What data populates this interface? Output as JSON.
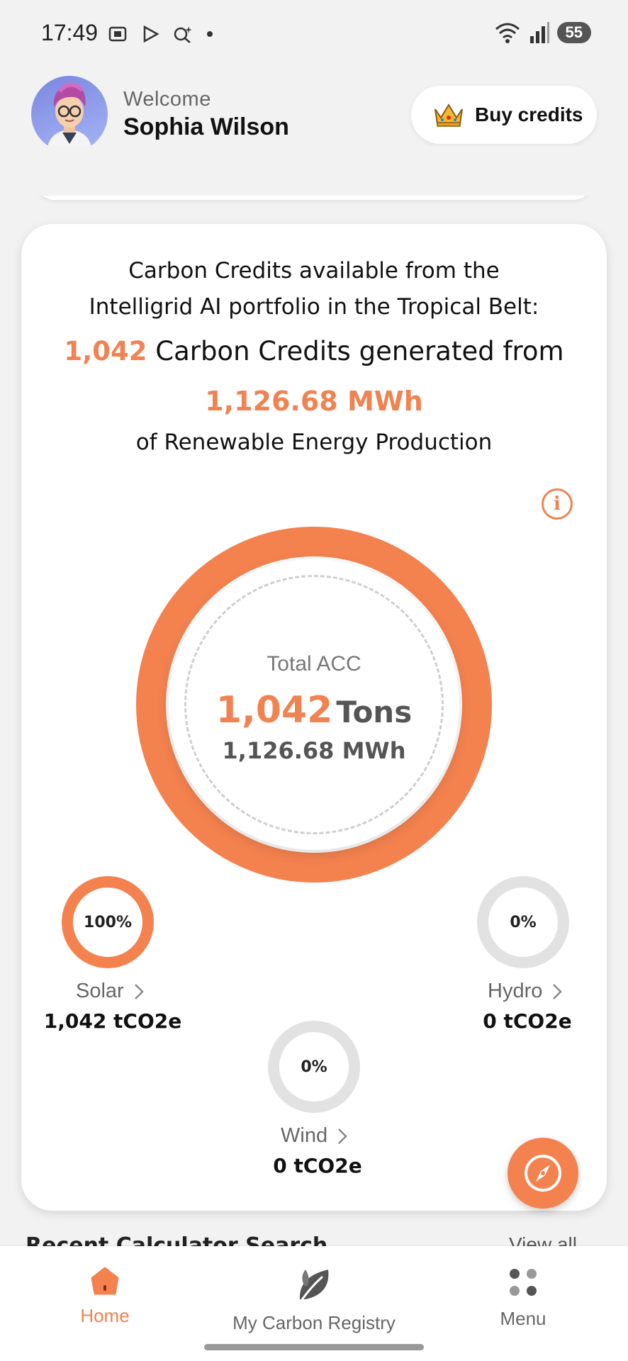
{
  "status_bar": {
    "time": "17:49",
    "battery": "55",
    "icons": [
      "screenshot-icon",
      "play-icon",
      "assistant-icon",
      "dot-icon",
      "wifi-icon",
      "signal-icon"
    ]
  },
  "header": {
    "welcome": "Welcome",
    "user_name": "Sophia Wilson",
    "buy_button": "Buy credits"
  },
  "summary": {
    "line1": "Carbon Credits available from the",
    "line2": "Intelligrid AI portfolio in the Tropical Belt:",
    "credits_count": "1,042",
    "line3_rest": " Carbon Credits generated from",
    "energy": "1,126.68 MWh",
    "line5": "of Renewable Energy Production"
  },
  "total": {
    "label": "Total ACC",
    "value": "1,042",
    "unit": "Tons",
    "energy": "1,126.68 MWh"
  },
  "sources": [
    {
      "name": "Solar",
      "percent": "100%",
      "value": "1,042 tCO2e",
      "active": true
    },
    {
      "name": "Hydro",
      "percent": "0%",
      "value": "0 tCO2e",
      "active": false
    },
    {
      "name": "Wind",
      "percent": "0%",
      "value": "0 tCO2e",
      "active": false
    }
  ],
  "recent": {
    "title": "Recent Calculator Search",
    "view_all": "View all"
  },
  "nav": {
    "home": "Home",
    "registry": "My Carbon Registry",
    "menu": "Menu"
  },
  "colors": {
    "accent": "#f08351",
    "ring_inactive": "#e2e2e2"
  }
}
